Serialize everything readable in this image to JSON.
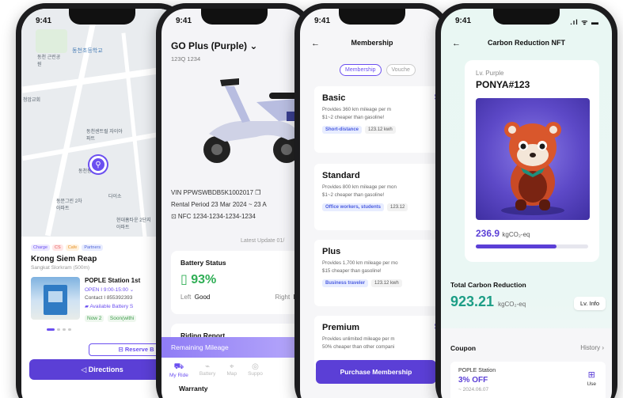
{
  "status": {
    "time": "9:41",
    "right_icons": ".ıl ᯤ ▬"
  },
  "map_screen": {
    "poi_labels": [
      "동천초등학교",
      "동천 근린공원",
      "청암교회",
      "동천센트럴 자이아파트",
      "동천동로",
      "동문그린 2차아파트",
      "다이소",
      "현대홈타운 2단지아파트"
    ],
    "tags": [
      "Charge",
      "CS",
      "Cafe",
      "Partners"
    ],
    "place_name": "Krong Siem Reap",
    "place_sub": "Sangkat Slorkram (500m)",
    "station_name": "POPLE Station 1st",
    "open": "OPEN I 9:00-15:00 ⌄",
    "contact": "Contact I 855392393",
    "battery_label": "▰ Available Battery S",
    "now": "Now  2",
    "soon": "Soon(withi",
    "reserve_label": "⊟ Reserve B",
    "directions_label": "◁  Directions"
  },
  "vehicle_screen": {
    "title": "GO Plus (Purple) ⌄",
    "plate": "123Q 1234",
    "vin": "VIN  PPWSWBDB5K1002017 ❐",
    "rental": "Rental Period  23 Mar 2024 ~ 23 A",
    "nfc": "⊡ NFC  1234-1234-1234-1234",
    "latest_update": "Latest Update 01/",
    "battery_title": "Battery Status",
    "battery_pct": "▯ 93%",
    "battery_percent_value": 93,
    "left_label": "Left",
    "left_value": "Good",
    "right_label": "Right",
    "right_value": "B",
    "riding_report": "Riding Report",
    "remaining_mileage": "Remaining Mileage",
    "tabs": [
      {
        "icon": "⛟",
        "label": "My Ride"
      },
      {
        "icon": "⌁",
        "label": "Battery"
      },
      {
        "icon": "⌖",
        "label": "Map"
      },
      {
        "icon": "◎",
        "label": "Suppo"
      }
    ],
    "warranty": "Warranty"
  },
  "membership_screen": {
    "back": "←",
    "title": "Membership",
    "seg_membership": "Membership",
    "seg_voucher": "Vouche",
    "plans": [
      {
        "name": "Basic",
        "desc": "Provides 360 km mileage per m",
        "desc2": "$1~2 cheaper than gasoline!",
        "chip1": "Short-distance",
        "chip2": "123.12 kwh",
        "price": "$"
      },
      {
        "name": "Standard",
        "desc": "Provides 800 km mileage per mon",
        "desc2": "$1~2 cheaper than gasoline!",
        "chip1": "Office workers, students",
        "chip2": "123.12",
        "price": ""
      },
      {
        "name": "Plus",
        "desc": "Provides 1,700 km mileage per mo",
        "desc2": "$15 cheaper than gasoline!",
        "chip1": "Business traveler",
        "chip2": "123.12 kwh",
        "price": ""
      },
      {
        "name": "Premium",
        "desc": "Provides unlimited mileage per m",
        "desc2": "50% cheaper than other compani",
        "chip1": "",
        "chip2": "",
        "price": "$"
      }
    ],
    "purchase_label": "Purchase Membership"
  },
  "nft_screen": {
    "back": "←",
    "title": "Carbon Reduction NFT",
    "level": "Lv. Purple",
    "name": "PONYA#123",
    "carbon_value": "236.9",
    "carbon_unit": "kgCO₂-eq",
    "progress_fraction": 0.72,
    "total_label": "Total Carbon Reduction",
    "total_value": "923.21",
    "total_unit": "kgCO₂-eq",
    "lv_info": "Lv. Info",
    "coupon_title": "Coupon",
    "history": "History  ›",
    "coupon_station": "POPLE Station",
    "coupon_pct": "3% OFF",
    "coupon_date": "~ 2024.06.07",
    "use": "Use",
    "qr_icon": "⊞"
  },
  "colors": {
    "brand_purple": "#5b3fd6",
    "battery_green": "#2fae55",
    "teal": "#1d9e86"
  }
}
